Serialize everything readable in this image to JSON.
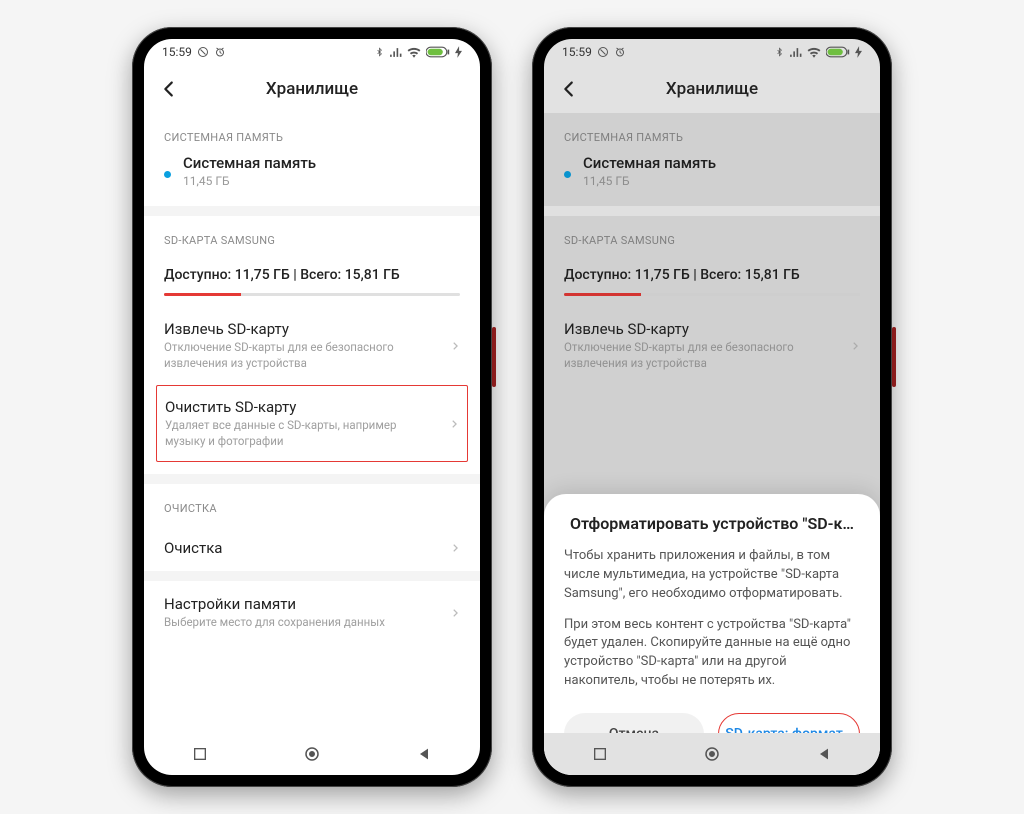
{
  "statusbar": {
    "time": "15:59"
  },
  "header": {
    "title": "Хранилище"
  },
  "sections": {
    "system_label": "СИСТЕМНАЯ ПАМЯТЬ",
    "system_title": "Системная память",
    "system_size": "11,45 ГБ",
    "sd_label": "SD-КАРТА SAMSUNG",
    "storage_line": "Доступно: 11,75 ГБ | Всего: 15,81 ГБ",
    "storage_used_pct": 26,
    "eject_title": "Извлечь SD-карту",
    "eject_sub": "Отключение SD-карты для ее безопасного извлечения из устройства",
    "clear_title": "Очистить SD-карту",
    "clear_sub": "Удаляет все данные с SD-карты, например музыку и фотографии",
    "cleanup_label": "ОЧИСТКА",
    "cleanup_title": "Очистка",
    "memsettings_title": "Настройки памяти",
    "memsettings_sub": "Выберите место для сохранения данных"
  },
  "dialog": {
    "title": "Отформатировать устройство \"SD-к…",
    "p1": "Чтобы хранить приложения и файлы, в том числе мультимедиа, на устройстве \"SD-карта Samsung\", его необходимо отформатировать.",
    "p2": "При этом весь контент с устройства \"SD-карта\" будет удален. Скопируйте данные на ещё одно устройство \"SD-карта\" или на другой накопитель, чтобы не потерять их.",
    "cancel": "Отмена",
    "confirm": "SD-карта: формат…"
  }
}
